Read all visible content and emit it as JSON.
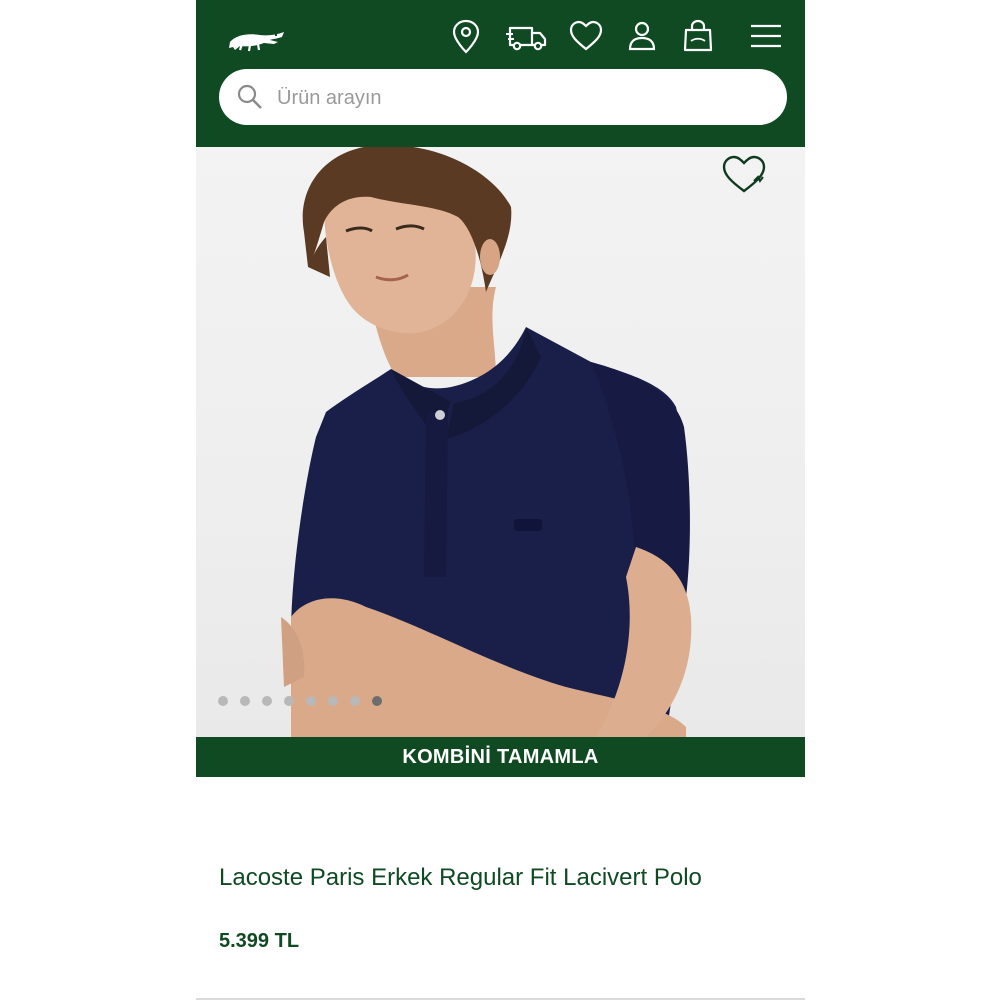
{
  "header": {
    "brand_logo": "crocodile-logo",
    "icons": [
      "location-pin-icon",
      "delivery-truck-icon",
      "heart-icon",
      "user-icon",
      "shopping-bag-icon",
      "menu-icon"
    ]
  },
  "search": {
    "placeholder": "Ürün arayın"
  },
  "gallery": {
    "favorite_icon": "heart-icon",
    "slide_count": 8,
    "active_slide": 8
  },
  "cta": {
    "label": "KOMBİNİ TAMAMLA"
  },
  "product": {
    "title": "Lacoste Paris Erkek Regular Fit Lacivert Polo",
    "price": "5.399 TL"
  },
  "colors": {
    "brand_green": "#0f4a23",
    "shirt_navy": "#1a1f4a"
  }
}
